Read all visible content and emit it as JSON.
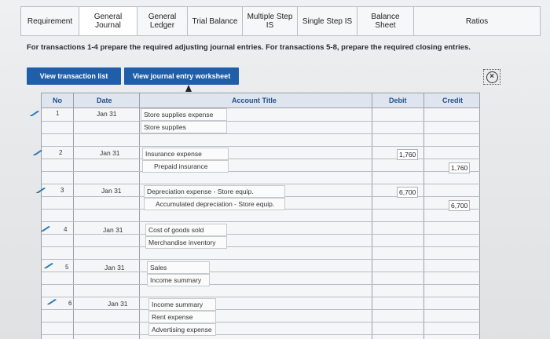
{
  "tabs": [
    {
      "label": "Requirement"
    },
    {
      "label": "General Journal"
    },
    {
      "label": "General Ledger"
    },
    {
      "label": "Trial Balance"
    },
    {
      "label": "Multiple Step IS"
    },
    {
      "label": "Single Step IS"
    },
    {
      "label": "Balance Sheet"
    },
    {
      "label": "Ratios"
    }
  ],
  "instructions": "For transactions 1-4 prepare the required adjusting journal entries. For transactions 5-8, prepare the required closing entries.",
  "buttons": {
    "view_transaction_list": "View transaction list",
    "view_journal_worksheet": "View journal entry worksheet"
  },
  "table": {
    "headers": {
      "no": "No",
      "date": "Date",
      "account_title": "Account Title",
      "debit": "Debit",
      "credit": "Credit"
    },
    "entries": [
      {
        "no": "1",
        "date": "Jan 31",
        "lines": [
          {
            "account": "Store supplies expense",
            "debit": "",
            "credit": ""
          },
          {
            "account": "Store supplies",
            "debit": "",
            "credit": ""
          }
        ]
      },
      {
        "no": "2",
        "date": "Jan 31",
        "lines": [
          {
            "account": "Insurance expense",
            "debit": "1,760",
            "credit": ""
          },
          {
            "account": "Prepaid insurance",
            "debit": "",
            "credit": "1,760"
          }
        ]
      },
      {
        "no": "3",
        "date": "Jan 31",
        "lines": [
          {
            "account": "Depreciation expense - Store equip.",
            "debit": "6,700",
            "credit": ""
          },
          {
            "account": "Accumulated depreciation - Store equip.",
            "debit": "",
            "credit": "6,700"
          }
        ]
      },
      {
        "no": "4",
        "date": "Jan 31",
        "lines": [
          {
            "account": "Cost of goods sold",
            "debit": "",
            "credit": ""
          },
          {
            "account": "Merchandise inventory",
            "debit": "",
            "credit": ""
          }
        ]
      },
      {
        "no": "5",
        "date": "Jan 31",
        "lines": [
          {
            "account": "Sales",
            "debit": "",
            "credit": ""
          },
          {
            "account": "Income summary",
            "debit": "",
            "credit": ""
          }
        ]
      },
      {
        "no": "6",
        "date": "Jan 31",
        "lines": [
          {
            "account": "Income summary",
            "debit": "",
            "credit": ""
          },
          {
            "account": "Rent expense",
            "debit": "",
            "credit": ""
          },
          {
            "account": "Advertising expense",
            "debit": "",
            "credit": ""
          }
        ]
      }
    ]
  },
  "colors": {
    "accent": "#1f5ea8",
    "header_text": "#1f4f8a",
    "pencil": "#2a7ab8"
  }
}
